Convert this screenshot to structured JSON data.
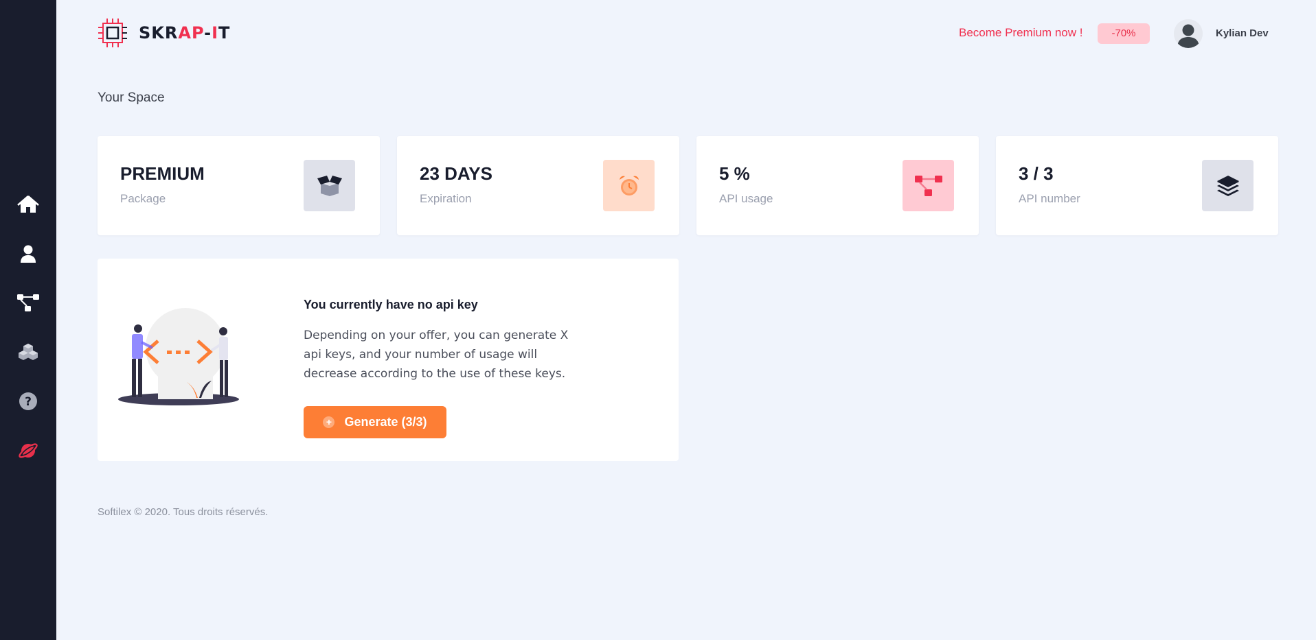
{
  "brand": {
    "name_part1": "SKR",
    "name_part2": "AP",
    "name_part3": "-",
    "name_part4": "I",
    "name_part5": "T",
    "logo_icon": "cpu-chip-icon"
  },
  "header": {
    "premium_cta": "Become Premium now !",
    "discount": "-70%",
    "user_name": "Kylian Dev",
    "avatar_icon": "user-avatar-icon"
  },
  "sidebar": {
    "items": [
      {
        "id": "home",
        "icon": "home-icon"
      },
      {
        "id": "profile",
        "icon": "user-icon"
      },
      {
        "id": "api",
        "icon": "network-icon"
      },
      {
        "id": "packages",
        "icon": "cubes-icon"
      },
      {
        "id": "help",
        "icon": "question-icon"
      },
      {
        "id": "logout",
        "icon": "planet-icon"
      }
    ]
  },
  "page": {
    "title": "Your Space"
  },
  "stats": [
    {
      "value": "PREMIUM",
      "label": "Package",
      "icon": "open-box-icon",
      "icon_bg": "#dfe1ea"
    },
    {
      "value": "23 DAYS",
      "label": "Expiration",
      "icon": "alarm-clock-icon",
      "icon_bg": "#ffdccb"
    },
    {
      "value": "5 %",
      "label": "API usage",
      "icon": "nodes-icon",
      "icon_bg": "#ffcad3"
    },
    {
      "value": "3 / 3",
      "label": "API number",
      "icon": "layers-icon",
      "icon_bg": "#dfe1ea"
    }
  ],
  "api_panel": {
    "title": "You currently have no api key",
    "description": "Depending on your offer, you can generate X api keys, and your number of usage will decrease according to the use of these keys.",
    "button_label": "Generate (3/3)",
    "button_icon": "plus-circle-icon",
    "illustration": "people-exchanging-code-illustration"
  },
  "footer": {
    "text": "Softilex © 2020. Tous droits réservés."
  },
  "colors": {
    "sidebar": "#191d2d",
    "background": "#f0f4fc",
    "accent_red": "#f0304f",
    "accent_orange": "#fd7e35"
  }
}
